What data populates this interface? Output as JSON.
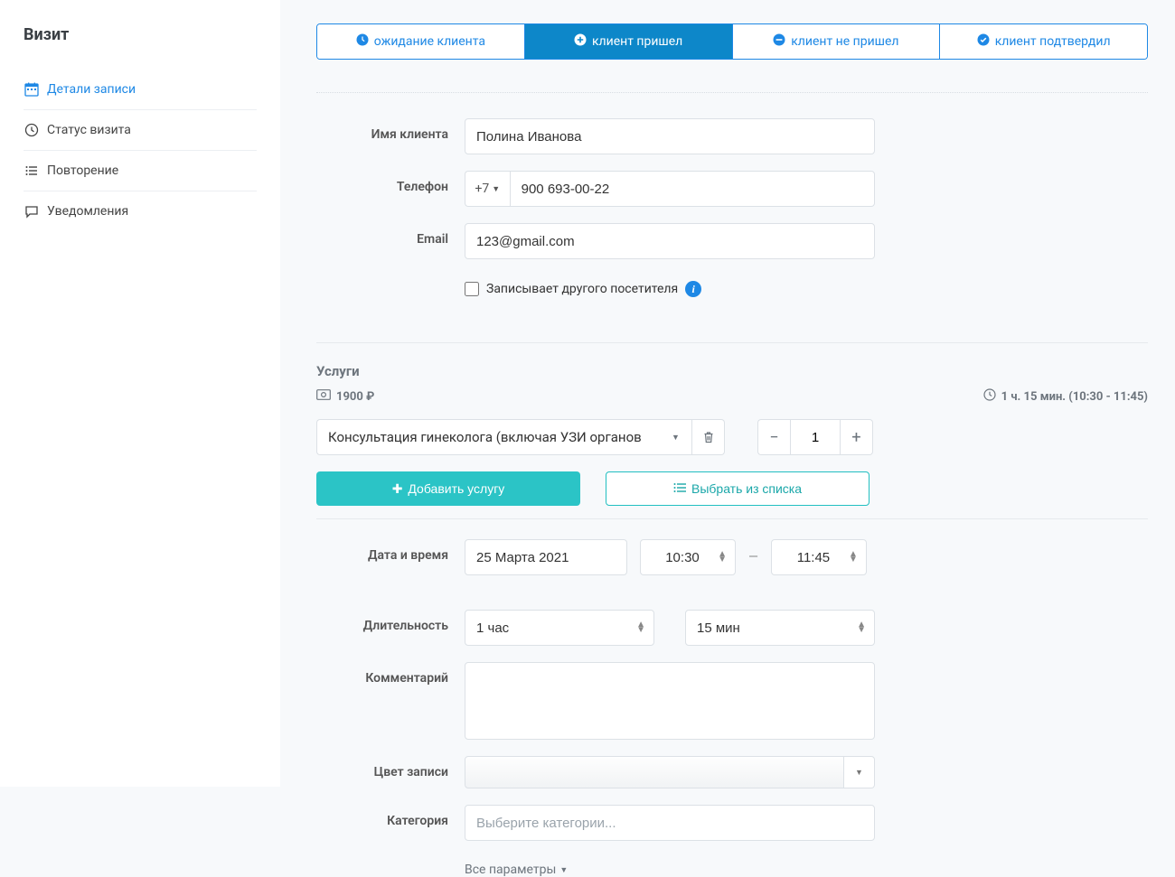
{
  "sidebar": {
    "title": "Визит",
    "items": [
      {
        "label": "Детали записи",
        "icon": "calendar-icon",
        "active": true
      },
      {
        "label": "Статус визита",
        "icon": "clock-icon",
        "active": false
      },
      {
        "label": "Повторение",
        "icon": "list-icon",
        "active": false
      },
      {
        "label": "Уведомления",
        "icon": "comment-icon",
        "active": false
      }
    ]
  },
  "status_tabs": [
    {
      "label": "ожидание клиента",
      "active": false
    },
    {
      "label": "клиент пришел",
      "active": true
    },
    {
      "label": "клиент не пришел",
      "active": false
    },
    {
      "label": "клиент подтвердил",
      "active": false
    }
  ],
  "form": {
    "client_name_label": "Имя клиента",
    "client_name_value": "Полина Иванова",
    "phone_label": "Телефон",
    "phone_code": "+7",
    "phone_value": "900 693-00-22",
    "email_label": "Email",
    "email_value": "123@gmail.com",
    "other_visitor_label": "Записывает другого посетителя",
    "date_label": "Дата и время",
    "date_value": "25 Марта 2021",
    "time_start": "10:30",
    "time_dash": "—",
    "time_end": "11:45",
    "duration_label": "Длительность",
    "duration_hours": "1 час",
    "duration_minutes": "15 мин",
    "comment_label": "Комментарий",
    "comment_value": "",
    "color_label": "Цвет записи",
    "category_label": "Категория",
    "category_placeholder": "Выберите категории...",
    "all_params": "Все параметры"
  },
  "services": {
    "title": "Услуги",
    "price": "1900 ₽",
    "duration_text": "1 ч. 15 мин. (10:30 - 11:45)",
    "selected": "Консультация гинеколога (включая УЗИ органов",
    "qty": "1",
    "add_button": "Добавить услугу",
    "pick_button": "Выбрать из списка"
  }
}
